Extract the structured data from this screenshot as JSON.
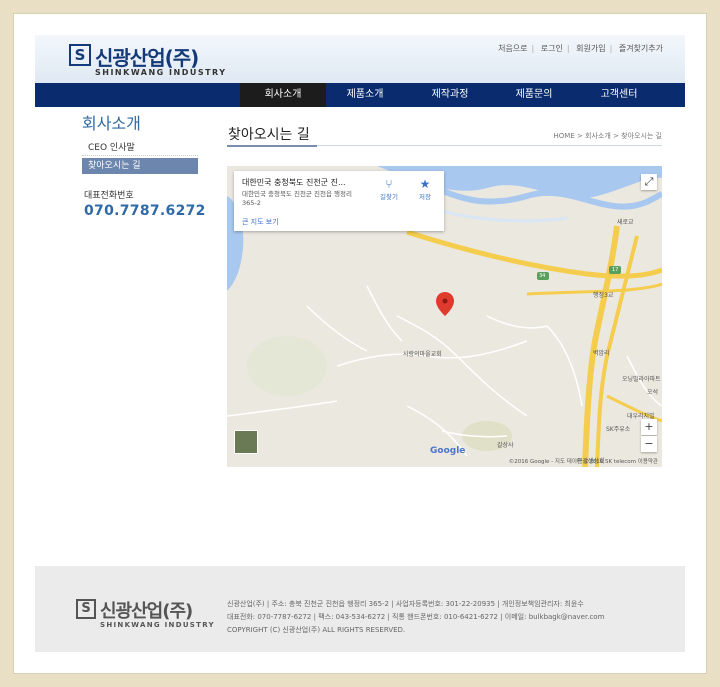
{
  "header": {
    "logo_mark": "S",
    "logo_name": "신광산업(주)",
    "logo_sub": "SHINKWANG INDUSTRY",
    "util_links": [
      "처음으로",
      "로그인",
      "회원가입",
      "즐겨찾기추가"
    ]
  },
  "nav": {
    "items": [
      "회사소개",
      "제품소개",
      "제작과정",
      "제품문의",
      "고객센터"
    ]
  },
  "sidebar": {
    "title": "회사소개",
    "menu": [
      "CEO 인사말",
      "찾아오시는 길"
    ],
    "phone_label": "대표전화번호",
    "phone": "070.7787.6272"
  },
  "content": {
    "title": "찾아오시는 길",
    "breadcrumb": "HOME > 회사소개 > 찾아오시는 길"
  },
  "map": {
    "info_title": "대한민국 충청북도 진천군 진...",
    "info_address": "대한민국 충청북도 진천군 진천읍 행정리 365-2",
    "info_link": "큰 지도 보기",
    "directions_label": "길찾기",
    "save_label": "저장",
    "zoom_in": "+",
    "zoom_out": "−",
    "google_label": "Google",
    "footer_text": "©2016 Google - 지도 데이터 ©2016 SK telecom    이용약관",
    "labels": {
      "l1": "사랑의마을교회",
      "l2": "갈상사",
      "l3": "행정3교",
      "l4": "오닝빌라아파트",
      "l5": "대우리지빌",
      "l6": "SK주유소",
      "l7": "벽암리",
      "l8": "새로교",
      "l9": "오석",
      "l10": "큰갈생상회",
      "road1": "34",
      "road2": "17"
    }
  },
  "footer": {
    "logo_mark": "S",
    "logo_name": "신광산업(주)",
    "logo_sub": "SHINKWANG INDUSTRY",
    "line1": "신광산업(주)  |  주소: 충북 진천군 진천읍 행정리 365-2  |  사업자등록번호: 301-22-20935  |  개인정보책임관리자: 최윤수",
    "line2": "대표전화: 070-7787-6272  |  팩스: 043-534-6272  |  직통 핸드폰번호: 010-6421-6272  |  이메일: bulkbagk@naver.com",
    "line3": "COPYRIGHT (C) 신광산업(주) ALL RIGHTS RESERVED."
  },
  "colors": {
    "nav_bg": "#0a2c6e",
    "brand_blue": "#143a7a",
    "accent": "#2f6aa6",
    "side_active": "#6d86ad"
  }
}
